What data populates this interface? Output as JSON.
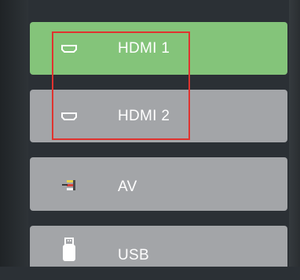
{
  "sources": [
    {
      "label": "HDMI 1",
      "icon": "hdmi-icon",
      "selected": true
    },
    {
      "label": "HDMI 2",
      "icon": "hdmi-icon",
      "selected": false
    },
    {
      "label": "AV",
      "icon": "av-cable-icon",
      "selected": false
    },
    {
      "label": "USB",
      "icon": "usb-drive-icon",
      "selected": false
    }
  ],
  "colors": {
    "selected_bg": "#84c47a",
    "item_bg": "#a3a5a8",
    "focus_outline": "#e0332f",
    "background": "#2b3035"
  }
}
